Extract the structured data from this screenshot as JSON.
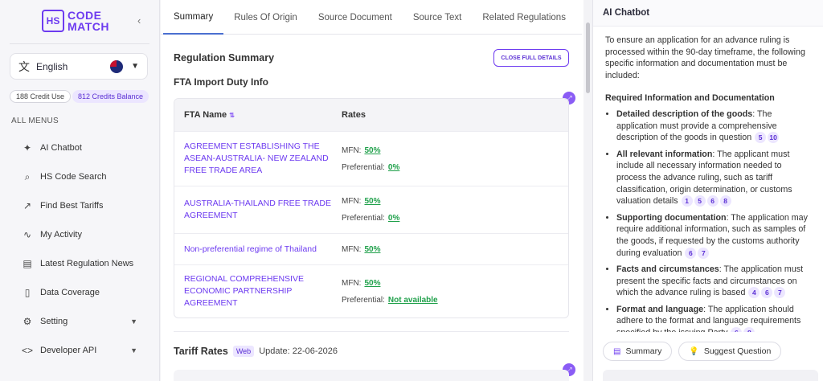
{
  "brand": {
    "badge": "HS",
    "line1": "CODE",
    "line2": "MATCH"
  },
  "sidebar": {
    "language": "English",
    "credit_use": "188 Credit Use",
    "credit_balance": "812 Credits Balance",
    "menus_title": "ALL MENUS",
    "items": [
      {
        "label": "AI Chatbot",
        "icon": "sparkle-icon"
      },
      {
        "label": "HS Code Search",
        "icon": "search-icon"
      },
      {
        "label": "Find Best Tariffs",
        "icon": "trend-icon"
      },
      {
        "label": "My Activity",
        "icon": "activity-icon"
      },
      {
        "label": "Latest Regulation News",
        "icon": "news-icon"
      },
      {
        "label": "Data Coverage",
        "icon": "document-icon"
      },
      {
        "label": "Setting",
        "icon": "gear-icon"
      },
      {
        "label": "Developer API",
        "icon": "code-icon"
      }
    ]
  },
  "tabs": [
    "Summary",
    "Rules Of Origin",
    "Source Document",
    "Source Text",
    "Related Regulations"
  ],
  "main": {
    "regulation_summary": "Regulation Summary",
    "close_button": "CLOSE FULL DETAILS",
    "fta_title": "FTA Import Duty Info",
    "table_headers": {
      "name": "FTA Name",
      "rates": "Rates"
    },
    "rows": [
      {
        "name": "AGREEMENT ESTABLISHING THE ASEAN-AUSTRALIA- NEW ZEALAND FREE TRADE AREA",
        "mfn": "50%",
        "preferential": "0%"
      },
      {
        "name": "AUSTRALIA-THAILAND FREE TRADE AGREEMENT",
        "mfn": "50%",
        "preferential": "0%"
      },
      {
        "name": "Non-preferential regime of Thailand",
        "mfn": "50%",
        "preferential": null
      },
      {
        "name": "REGIONAL COMPREHENSIVE ECONOMIC PARTNERSHIP AGREEMENT",
        "mfn": "50%",
        "preferential": "Not available"
      }
    ],
    "mfn_label": "MFN:",
    "preferential_label": "Preferential:",
    "tariff_title": "Tariff Rates",
    "tariff_badge": "Web",
    "tariff_update": "Update: 22-06-2026"
  },
  "chat": {
    "title": "AI Chatbot",
    "intro": "To ensure an application for an advance ruling is processed within the 90-day timeframe, the following specific information and documentation must be included:",
    "heading": "Required Information and Documentation",
    "items": [
      {
        "bold": "Detailed description of the goods",
        "text": ": The application must provide a comprehensive description of the goods in question",
        "cites": [
          "5",
          "10"
        ]
      },
      {
        "bold": "All relevant information",
        "text": ": The applicant must include all necessary information needed to process the advance ruling, such as tariff classification, origin determination, or customs valuation details",
        "cites": [
          "1",
          "5",
          "6",
          "8"
        ]
      },
      {
        "bold": "Supporting documentation",
        "text": ": The application may require additional information, such as samples of the goods, if requested by the customs authority during evaluation",
        "cites": [
          "6",
          "7"
        ]
      },
      {
        "bold": "Facts and circumstances",
        "text": ": The application must present the specific facts and circumstances on which the advance ruling is based",
        "cites": [
          "4",
          "6",
          "7"
        ]
      },
      {
        "bold": "Format and language",
        "text": ": The application should adhere to the format and language requirements specified by the issuing Party",
        "cites": [
          "6",
          "8"
        ]
      }
    ],
    "summary_button": "Summary",
    "suggest_button": "Suggest Question"
  }
}
